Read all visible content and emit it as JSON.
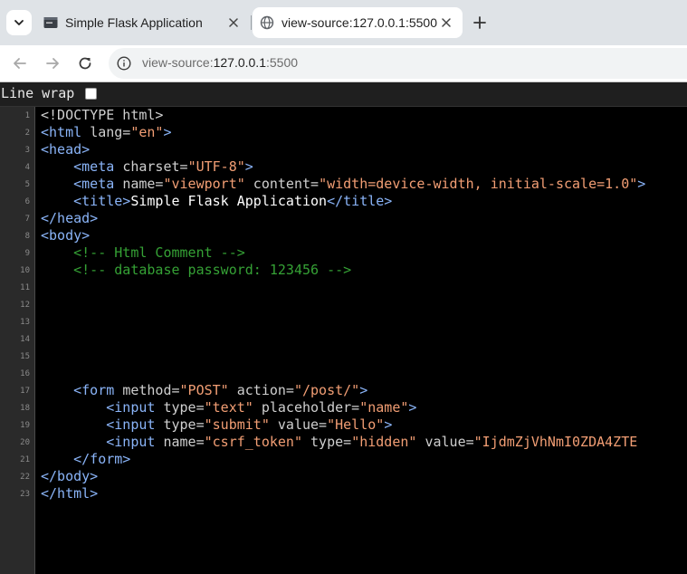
{
  "tabs": [
    {
      "title": "Simple Flask Application",
      "active": false
    },
    {
      "title": "view-source:127.0.0.1:5500",
      "active": true
    }
  ],
  "address_bar": {
    "scheme": "view-source:",
    "host": "127.0.0.1",
    "port": ":5500"
  },
  "line_wrap": {
    "label": "Line wrap",
    "checked": false
  },
  "source_lines": [
    {
      "n": "1",
      "tokens": [
        [
          "doctype",
          "<!DOCTYPE html>"
        ]
      ]
    },
    {
      "n": "2",
      "tokens": [
        [
          "tag",
          "<html "
        ],
        [
          "attr",
          "lang="
        ],
        [
          "val",
          "\"en\""
        ],
        [
          "tag",
          ">"
        ]
      ]
    },
    {
      "n": "3",
      "tokens": [
        [
          "tag",
          "<head>"
        ]
      ]
    },
    {
      "n": "4",
      "tokens": [
        [
          "txt",
          "    "
        ],
        [
          "tag",
          "<meta "
        ],
        [
          "attr",
          "charset="
        ],
        [
          "val",
          "\"UTF-8\""
        ],
        [
          "tag",
          ">"
        ]
      ]
    },
    {
      "n": "5",
      "tokens": [
        [
          "txt",
          "    "
        ],
        [
          "tag",
          "<meta "
        ],
        [
          "attr",
          "name="
        ],
        [
          "val",
          "\"viewport\""
        ],
        [
          "attr",
          " content="
        ],
        [
          "val",
          "\"width=device-width, initial-scale=1.0\""
        ],
        [
          "tag",
          ">"
        ]
      ]
    },
    {
      "n": "6",
      "tokens": [
        [
          "txt",
          "    "
        ],
        [
          "tag",
          "<title>"
        ],
        [
          "txt",
          "Simple Flask Application"
        ],
        [
          "tag",
          "</title>"
        ]
      ]
    },
    {
      "n": "7",
      "tokens": [
        [
          "tag",
          "</head>"
        ]
      ]
    },
    {
      "n": "8",
      "tokens": [
        [
          "tag",
          "<body>"
        ]
      ]
    },
    {
      "n": "9",
      "tokens": [
        [
          "txt",
          "    "
        ],
        [
          "cmt",
          "<!-- Html Comment -->"
        ]
      ]
    },
    {
      "n": "10",
      "tokens": [
        [
          "txt",
          "    "
        ],
        [
          "cmt",
          "<!-- database password: 123456 -->"
        ]
      ]
    },
    {
      "n": "11",
      "tokens": []
    },
    {
      "n": "12",
      "tokens": []
    },
    {
      "n": "13",
      "tokens": []
    },
    {
      "n": "14",
      "tokens": []
    },
    {
      "n": "15",
      "tokens": []
    },
    {
      "n": "16",
      "tokens": []
    },
    {
      "n": "17",
      "tokens": [
        [
          "txt",
          "    "
        ],
        [
          "tag",
          "<form "
        ],
        [
          "attr",
          "method="
        ],
        [
          "val",
          "\"POST\""
        ],
        [
          "attr",
          " action="
        ],
        [
          "val",
          "\"/post/\""
        ],
        [
          "tag",
          ">"
        ]
      ]
    },
    {
      "n": "18",
      "tokens": [
        [
          "txt",
          "        "
        ],
        [
          "tag",
          "<input "
        ],
        [
          "attr",
          "type="
        ],
        [
          "val",
          "\"text\""
        ],
        [
          "attr",
          " placeholder="
        ],
        [
          "val",
          "\"name\""
        ],
        [
          "tag",
          ">"
        ]
      ]
    },
    {
      "n": "19",
      "tokens": [
        [
          "txt",
          "        "
        ],
        [
          "tag",
          "<input "
        ],
        [
          "attr",
          "type="
        ],
        [
          "val",
          "\"submit\""
        ],
        [
          "attr",
          " value="
        ],
        [
          "val",
          "\"Hello\""
        ],
        [
          "tag",
          ">"
        ]
      ]
    },
    {
      "n": "20",
      "tokens": [
        [
          "txt",
          "        "
        ],
        [
          "tag",
          "<input "
        ],
        [
          "attr",
          "name="
        ],
        [
          "val",
          "\"csrf_token\""
        ],
        [
          "attr",
          " type="
        ],
        [
          "val",
          "\"hidden\""
        ],
        [
          "attr",
          " value="
        ],
        [
          "val",
          "\"IjdmZjVhNmI0ZDA4ZTE"
        ]
      ]
    },
    {
      "n": "21",
      "tokens": [
        [
          "txt",
          "    "
        ],
        [
          "tag",
          "</form>"
        ]
      ]
    },
    {
      "n": "22",
      "tokens": [
        [
          "tag",
          "</body>"
        ]
      ]
    },
    {
      "n": "23",
      "tokens": [
        [
          "tag",
          "</html>"
        ]
      ]
    }
  ],
  "icons": {
    "tab_menu": "chevron-down-icon",
    "tab1_favicon": "terminal-icon",
    "tab2_favicon": "globe-icon",
    "close": "close-icon",
    "new_tab": "plus-icon",
    "back": "back-arrow-icon",
    "forward": "forward-arrow-icon",
    "reload": "reload-icon",
    "site_info": "info-icon"
  },
  "colors": {
    "tag": "#8ab4f8",
    "attribute_value": "#f29e74",
    "comment": "#35a135",
    "text": "#ffffff"
  }
}
